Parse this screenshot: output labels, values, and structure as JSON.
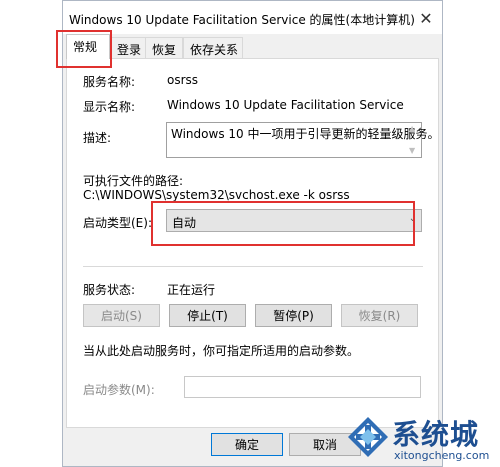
{
  "window": {
    "title": "Windows 10 Update Facilitation Service 的属性(本地计算机)",
    "close_glyph": "✕"
  },
  "tabs": [
    {
      "label": "常规",
      "active": true
    },
    {
      "label": "登录",
      "active": false
    },
    {
      "label": "恢复",
      "active": false
    },
    {
      "label": "依存关系",
      "active": false
    }
  ],
  "general": {
    "service_name_label": "服务名称:",
    "service_name_value": "osrss",
    "display_name_label": "显示名称:",
    "display_name_value": "Windows 10 Update Facilitation Service",
    "description_label": "描述:",
    "description_value": "Windows 10 中一项用于引导更新的轻量级服务。",
    "exe_path_label": "可执行文件的路径:",
    "exe_path_value": "C:\\WINDOWS\\system32\\svchost.exe -k osrss",
    "startup_type_label": "启动类型(E):",
    "startup_type_value": "自动",
    "service_status_label": "服务状态:",
    "service_status_value": "正在运行",
    "buttons": {
      "start": "启动(S)",
      "stop": "停止(T)",
      "pause": "暂停(P)",
      "resume": "恢复(R)"
    },
    "hint_text": "当从此处启动服务时，你可指定所适用的启动参数。",
    "start_params_label": "启动参数(M):",
    "start_params_value": ""
  },
  "footer": {
    "ok": "确定",
    "cancel": "取消"
  },
  "watermark": {
    "brand": "系统城",
    "url": "xitongcheng.com"
  },
  "colors": {
    "highlight": "#e0312f",
    "dialog_bg": "#f0f0f0",
    "brand_blue": "#1e4f91"
  }
}
